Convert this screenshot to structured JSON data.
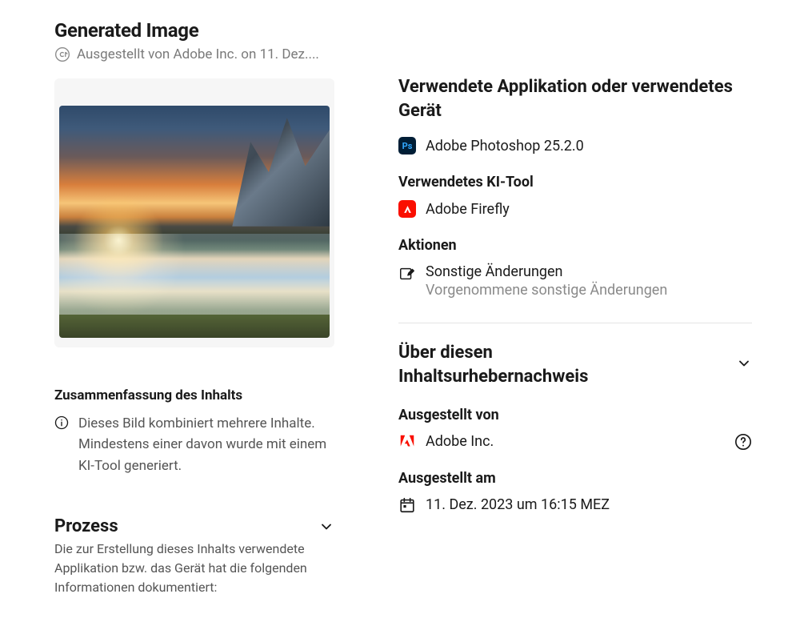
{
  "header": {
    "title": "Generated Image",
    "subtitle": "Ausgestellt von Adobe Inc. on 11. Dez...."
  },
  "summary": {
    "heading": "Zusammenfassung des Inhalts",
    "text": "Dieses Bild kombiniert mehrere Inhalte. Mindestens einer davon wurde mit einem KI-Tool generiert."
  },
  "process": {
    "heading": "Prozess",
    "note": "Die zur Erstellung dieses Inhalts verwendete Applikation bzw. das Gerät hat die folgenden Informationen dokumentiert:"
  },
  "right": {
    "appHeading": "Verwendete Applikation oder verwendetes Gerät",
    "appName": "Adobe Photoshop 25.2.0",
    "aiHeading": "Verwendetes KI-Tool",
    "aiName": "Adobe Firefly",
    "actionsHeading": "Aktionen",
    "actionPrimary": "Sonstige Änderungen",
    "actionSecondary": "Vorgenommene sonstige Änderungen",
    "aboutHeading": "Über diesen Inhaltsurhebernachweis",
    "issuedByHeading": "Ausgestellt von",
    "issuer": "Adobe Inc.",
    "issuedAtHeading": "Ausgestellt am",
    "issuedAt": "11. Dez. 2023 um 16:15 MEZ"
  }
}
